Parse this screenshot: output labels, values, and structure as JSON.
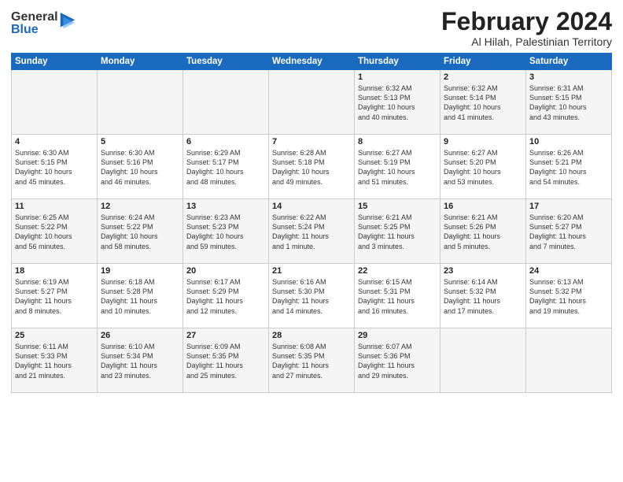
{
  "logo": {
    "general": "General",
    "blue": "Blue"
  },
  "title": "February 2024",
  "location": "Al Hilah, Palestinian Territory",
  "headers": [
    "Sunday",
    "Monday",
    "Tuesday",
    "Wednesday",
    "Thursday",
    "Friday",
    "Saturday"
  ],
  "weeks": [
    [
      {
        "day": "",
        "info": ""
      },
      {
        "day": "",
        "info": ""
      },
      {
        "day": "",
        "info": ""
      },
      {
        "day": "",
        "info": ""
      },
      {
        "day": "1",
        "info": "Sunrise: 6:32 AM\nSunset: 5:13 PM\nDaylight: 10 hours\nand 40 minutes."
      },
      {
        "day": "2",
        "info": "Sunrise: 6:32 AM\nSunset: 5:14 PM\nDaylight: 10 hours\nand 41 minutes."
      },
      {
        "day": "3",
        "info": "Sunrise: 6:31 AM\nSunset: 5:15 PM\nDaylight: 10 hours\nand 43 minutes."
      }
    ],
    [
      {
        "day": "4",
        "info": "Sunrise: 6:30 AM\nSunset: 5:15 PM\nDaylight: 10 hours\nand 45 minutes."
      },
      {
        "day": "5",
        "info": "Sunrise: 6:30 AM\nSunset: 5:16 PM\nDaylight: 10 hours\nand 46 minutes."
      },
      {
        "day": "6",
        "info": "Sunrise: 6:29 AM\nSunset: 5:17 PM\nDaylight: 10 hours\nand 48 minutes."
      },
      {
        "day": "7",
        "info": "Sunrise: 6:28 AM\nSunset: 5:18 PM\nDaylight: 10 hours\nand 49 minutes."
      },
      {
        "day": "8",
        "info": "Sunrise: 6:27 AM\nSunset: 5:19 PM\nDaylight: 10 hours\nand 51 minutes."
      },
      {
        "day": "9",
        "info": "Sunrise: 6:27 AM\nSunset: 5:20 PM\nDaylight: 10 hours\nand 53 minutes."
      },
      {
        "day": "10",
        "info": "Sunrise: 6:26 AM\nSunset: 5:21 PM\nDaylight: 10 hours\nand 54 minutes."
      }
    ],
    [
      {
        "day": "11",
        "info": "Sunrise: 6:25 AM\nSunset: 5:22 PM\nDaylight: 10 hours\nand 56 minutes."
      },
      {
        "day": "12",
        "info": "Sunrise: 6:24 AM\nSunset: 5:22 PM\nDaylight: 10 hours\nand 58 minutes."
      },
      {
        "day": "13",
        "info": "Sunrise: 6:23 AM\nSunset: 5:23 PM\nDaylight: 10 hours\nand 59 minutes."
      },
      {
        "day": "14",
        "info": "Sunrise: 6:22 AM\nSunset: 5:24 PM\nDaylight: 11 hours\nand 1 minute."
      },
      {
        "day": "15",
        "info": "Sunrise: 6:21 AM\nSunset: 5:25 PM\nDaylight: 11 hours\nand 3 minutes."
      },
      {
        "day": "16",
        "info": "Sunrise: 6:21 AM\nSunset: 5:26 PM\nDaylight: 11 hours\nand 5 minutes."
      },
      {
        "day": "17",
        "info": "Sunrise: 6:20 AM\nSunset: 5:27 PM\nDaylight: 11 hours\nand 7 minutes."
      }
    ],
    [
      {
        "day": "18",
        "info": "Sunrise: 6:19 AM\nSunset: 5:27 PM\nDaylight: 11 hours\nand 8 minutes."
      },
      {
        "day": "19",
        "info": "Sunrise: 6:18 AM\nSunset: 5:28 PM\nDaylight: 11 hours\nand 10 minutes."
      },
      {
        "day": "20",
        "info": "Sunrise: 6:17 AM\nSunset: 5:29 PM\nDaylight: 11 hours\nand 12 minutes."
      },
      {
        "day": "21",
        "info": "Sunrise: 6:16 AM\nSunset: 5:30 PM\nDaylight: 11 hours\nand 14 minutes."
      },
      {
        "day": "22",
        "info": "Sunrise: 6:15 AM\nSunset: 5:31 PM\nDaylight: 11 hours\nand 16 minutes."
      },
      {
        "day": "23",
        "info": "Sunrise: 6:14 AM\nSunset: 5:32 PM\nDaylight: 11 hours\nand 17 minutes."
      },
      {
        "day": "24",
        "info": "Sunrise: 6:13 AM\nSunset: 5:32 PM\nDaylight: 11 hours\nand 19 minutes."
      }
    ],
    [
      {
        "day": "25",
        "info": "Sunrise: 6:11 AM\nSunset: 5:33 PM\nDaylight: 11 hours\nand 21 minutes."
      },
      {
        "day": "26",
        "info": "Sunrise: 6:10 AM\nSunset: 5:34 PM\nDaylight: 11 hours\nand 23 minutes."
      },
      {
        "day": "27",
        "info": "Sunrise: 6:09 AM\nSunset: 5:35 PM\nDaylight: 11 hours\nand 25 minutes."
      },
      {
        "day": "28",
        "info": "Sunrise: 6:08 AM\nSunset: 5:35 PM\nDaylight: 11 hours\nand 27 minutes."
      },
      {
        "day": "29",
        "info": "Sunrise: 6:07 AM\nSunset: 5:36 PM\nDaylight: 11 hours\nand 29 minutes."
      },
      {
        "day": "",
        "info": ""
      },
      {
        "day": "",
        "info": ""
      }
    ]
  ]
}
